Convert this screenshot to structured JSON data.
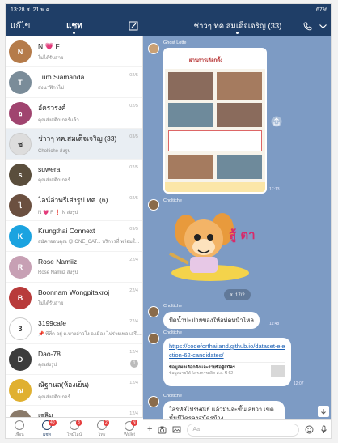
{
  "status_bar": {
    "time": "13:28 ส. 21 พ.ค.",
    "battery": "67%"
  },
  "left_header": {
    "edit_label": "แก้ไข",
    "title": "แชท"
  },
  "chat_header": {
    "title": "ช่าวๆ ทค.สมเด็จเจริญ (33)"
  },
  "chats": [
    {
      "name": "N 💗 F",
      "sub": "ไม่ได้รับสาย",
      "date": "",
      "color": "#b57b4a",
      "initial": "N"
    },
    {
      "name": "Tum Siamanda",
      "sub": "ส่งนาฬิกาไม่",
      "date": "02/5",
      "color": "#7a8c99",
      "initial": "T"
    },
    {
      "name": "อัครวรงค์",
      "sub": "คุณส่งสติกเกอร์แล้ว",
      "date": "02/5",
      "color": "#a0446f",
      "initial": "อ"
    },
    {
      "name": "ช่าวๆ ทค.สมเด็จเจริญ (33)",
      "sub": "Choltiche ส่งรูป",
      "date": "03/5",
      "color": "#dddddd",
      "initial": "ช"
    },
    {
      "name": "suwera",
      "sub": "คุณส่งสติกเกอร์",
      "date": "02/5",
      "color": "#5a4e3c",
      "initial": "s"
    },
    {
      "name": "ไลน์ล่าพรีเส่งรูป ทค. (6)",
      "sub": "N 💗 F ❗ N ส่งรูป",
      "date": "02/5",
      "color": "#6b5040",
      "initial": "ไ"
    },
    {
      "name": "Krungthai Connext",
      "sub": "สมัครออนคุณ 😊 ONE_CAT... บริการที่ พร้อมใช้เพิ่ม ฟิรเวอร์",
      "date": "09/5",
      "color": "#1ba3e0",
      "initial": "K"
    },
    {
      "name": "Rose Namiiz",
      "sub": "Rose Namiiz ส่งรูป",
      "date": "22/4",
      "color": "#c7a0b4",
      "initial": "R"
    },
    {
      "name": "Boonnam Wongpitakroj",
      "sub": "ไม่ได้รับสาย",
      "date": "22/4",
      "color": "#b83b3b",
      "initial": "B"
    },
    {
      "name": "3199cafe",
      "sub": "📌 พีที่ด อยู่ ต.บางล่าวโง อ.เมือง ไปร่ายเพอ เสรีย google map...",
      "date": "22/4",
      "color": "#ffffff",
      "initial": "3"
    },
    {
      "name": "Dao-78",
      "sub": "คุณส่งรูป",
      "date": "12/4",
      "color": "#3c3c3c",
      "initial": "D",
      "badge": "1"
    },
    {
      "name": "ณัฐกนล(ห้องเย็น)",
      "sub": "คุณส่งสติกเกอร์",
      "date": "12/4",
      "color": "#e0b030",
      "initial": "ณ"
    },
    {
      "name": "เจลิม",
      "sub": "รบกวนที่ร่วมหัวดูไฟหน่อยเปล่าค่ะ",
      "date": "12/4",
      "color": "#8a7a6a",
      "initial": "จ"
    }
  ],
  "tabs": [
    {
      "label": "เพื่อน",
      "badge": ""
    },
    {
      "label": "แชท",
      "badge": "40"
    },
    {
      "label": "ไทม์ไลน์",
      "badge": "3"
    },
    {
      "label": "โทร",
      "badge": "2"
    },
    {
      "label": "Wallet",
      "badge": "N"
    }
  ],
  "messages": {
    "poster_sender": "Ghost Lotte",
    "poster_heading": "ผ่านการเลือกตั้ง",
    "poster_time": "17:13",
    "sticker_sender": "Choltiche",
    "sticker_text": "สู้ ตาย!!",
    "date_divider": "ส. 17/2",
    "msg1_sender": "Choltiche",
    "msg1_text": "ปัดน้ำปะปายของให้อท์ดหน้าไหล",
    "msg1_time": "11:48",
    "msg2_sender": "Choltiche",
    "msg2_link": "https://codeforthailand.github.io/dataset-election-62-candidates/",
    "msg2_preview_title": "ข้อมูลผลเลือกตั้งและรายชื่อผู้สมัคร",
    "msg2_preview_desc": "ข้อมูลรายได้ โครงการผลิต ส.ส. ปี 62",
    "msg2_time": "12:07",
    "msg3_sender": "Choltiche",
    "msg3_text": "ใส่รหัสไปรษณีย์ แล้วมันจะขึ้นเลยว่า เขต นั้นมีใครลงสมัครบ้าง"
  },
  "input": {
    "placeholder": "Aa"
  },
  "colors": {
    "header": "#1f3e67",
    "chat_bg": "#7d9bc4",
    "accent": "#e53e3e"
  }
}
